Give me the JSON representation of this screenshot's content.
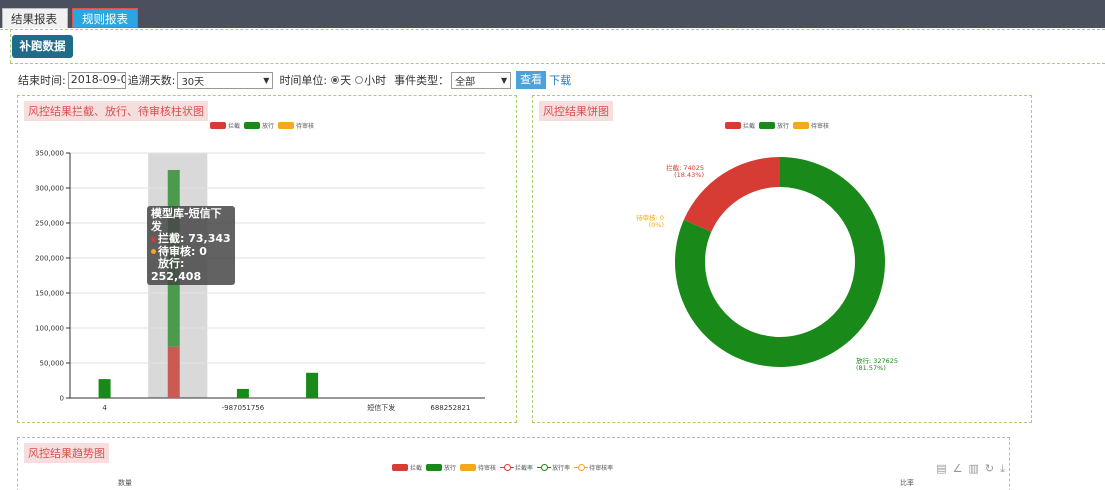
{
  "tabs": {
    "results": "结果报表",
    "rules": "规则报表"
  },
  "toolbar": {
    "fill_data": "补跑数据"
  },
  "filters": {
    "end_time_label": "结束时间:",
    "end_time_value": "2018-09-0",
    "trace_days_label": "追溯天数:",
    "trace_days_value": "30天",
    "time_unit_label": "时间单位:",
    "unit_day": "天",
    "unit_hour": "小时",
    "event_type_label": "事件类型：",
    "event_type_value": "全部",
    "query": "查看",
    "download": "下载"
  },
  "legend": {
    "block": "拦截",
    "pass": "放行",
    "pending": "待审核",
    "block_rate": "拦截率",
    "pass_rate": "放行率",
    "pending_rate": "待审核率"
  },
  "colors": {
    "block": "#d63b34",
    "pass": "#198a19",
    "pending": "#f6a917"
  },
  "bar_panel": {
    "title": "风控结果拦截、放行、待审核柱状图"
  },
  "pie_panel": {
    "title": "风控结果饼图"
  },
  "trend_panel": {
    "title": "风控结果趋势图",
    "y_left": "数量",
    "y_right": "比率"
  },
  "tooltip": {
    "title": "模型库-短信下发",
    "block": "拦截: 73,343",
    "pending": "待审核: 0",
    "pass": "放行: 252,408"
  },
  "icons": [
    "data-view-icon",
    "line-chart-icon",
    "bar-chart-icon",
    "restore-icon",
    "save-image-icon"
  ],
  "chart_data": [
    {
      "type": "bar",
      "stacked": true,
      "categories": [
        "4",
        "",
        "-987051756",
        "",
        "短信下发",
        "688252821"
      ],
      "series": [
        {
          "name": "拦截",
          "values": [
            0,
            73343,
            0,
            0,
            0,
            0
          ]
        },
        {
          "name": "放行",
          "values": [
            27000,
            252408,
            13000,
            36000,
            0,
            0
          ]
        },
        {
          "name": "待审核",
          "values": [
            0,
            0,
            0,
            0,
            0,
            0
          ]
        }
      ],
      "ylim": [
        0,
        350000
      ],
      "yticks": [
        "0",
        "50,000",
        "100,000",
        "150,000",
        "200,000",
        "250,000",
        "300,000",
        "350,000"
      ],
      "grid": true,
      "legend": "top-right",
      "highlighted_index": 1
    },
    {
      "type": "pie",
      "donut": true,
      "slices": [
        {
          "name": "拦截",
          "value": 74025,
          "label": "拦截: 74025",
          "pct": "(18.43%)"
        },
        {
          "name": "待审核",
          "value": 0,
          "label": "待审核: 0",
          "pct": "(0%)"
        },
        {
          "name": "放行",
          "value": 327625,
          "label": "放行: 327625",
          "pct": "(81.57%)"
        }
      ],
      "legend": "top"
    }
  ]
}
